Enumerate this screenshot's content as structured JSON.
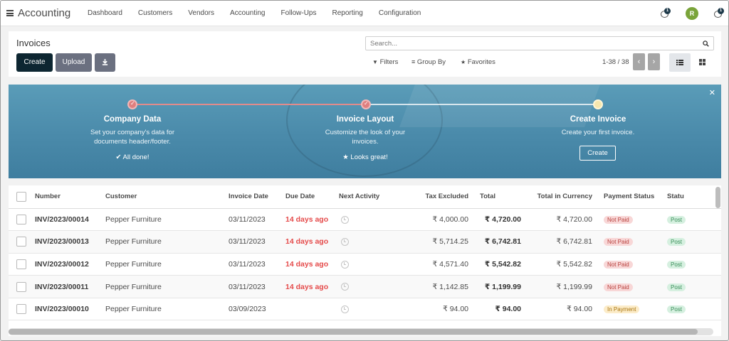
{
  "app": {
    "title": "Accounting"
  },
  "menu": [
    "Dashboard",
    "Customers",
    "Vendors",
    "Accounting",
    "Follow-Ups",
    "Reporting",
    "Configuration"
  ],
  "systray": {
    "activity_count": "1",
    "messages_count": "1",
    "avatar_initial": "R"
  },
  "control": {
    "breadcrumb": "Invoices",
    "create_label": "Create",
    "upload_label": "Upload",
    "search_placeholder": "Search...",
    "filters_label": "Filters",
    "groupby_label": "Group By",
    "favorites_label": "Favorites",
    "pager_value": "1-38 / 38"
  },
  "onboarding": {
    "steps": [
      {
        "title": "Company Data",
        "desc_line1": "Set your company's data for",
        "desc_line2": "documents header/footer.",
        "status": "All done!"
      },
      {
        "title": "Invoice Layout",
        "desc_line1": "Customize the look of your",
        "desc_line2": "invoices.",
        "status": "Looks great!"
      },
      {
        "title": "Create Invoice",
        "desc_line1": "Create your first invoice.",
        "button": "Create"
      }
    ]
  },
  "table": {
    "columns": [
      "Number",
      "Customer",
      "Invoice Date",
      "Due Date",
      "Next Activity",
      "Tax Excluded",
      "Total",
      "Total in Currency",
      "Payment Status",
      "Statu"
    ],
    "rows": [
      {
        "number": "INV/2023/00014",
        "customer": "Pepper Furniture",
        "invoice_date": "03/11/2023",
        "due": "14 days ago",
        "tax_excluded": "₹ 4,000.00",
        "total": "₹ 4,720.00",
        "total_currency": "₹ 4,720.00",
        "payment_status": "Not Paid",
        "status": "Post"
      },
      {
        "number": "INV/2023/00013",
        "customer": "Pepper Furniture",
        "invoice_date": "03/11/2023",
        "due": "14 days ago",
        "tax_excluded": "₹ 5,714.25",
        "total": "₹ 6,742.81",
        "total_currency": "₹ 6,742.81",
        "payment_status": "Not Paid",
        "status": "Post"
      },
      {
        "number": "INV/2023/00012",
        "customer": "Pepper Furniture",
        "invoice_date": "03/11/2023",
        "due": "14 days ago",
        "tax_excluded": "₹ 4,571.40",
        "total": "₹ 5,542.82",
        "total_currency": "₹ 5,542.82",
        "payment_status": "Not Paid",
        "status": "Post"
      },
      {
        "number": "INV/2023/00011",
        "customer": "Pepper Furniture",
        "invoice_date": "03/11/2023",
        "due": "14 days ago",
        "tax_excluded": "₹ 1,142.85",
        "total": "₹ 1,199.99",
        "total_currency": "₹ 1,199.99",
        "payment_status": "Not Paid",
        "status": "Post"
      },
      {
        "number": "INV/2023/00010",
        "customer": "Pepper Furniture",
        "invoice_date": "03/09/2023",
        "due": "",
        "tax_excluded": "₹ 94.00",
        "total": "₹ 94.00",
        "total_currency": "₹ 94.00",
        "payment_status": "In Payment",
        "status": "Post"
      }
    ]
  },
  "colors": {
    "primary": "#0d2631",
    "secondary": "#6b7080",
    "banner": "#4a8aaa",
    "overdue": "#e54b4b",
    "accent_done": "#e07f7f"
  }
}
